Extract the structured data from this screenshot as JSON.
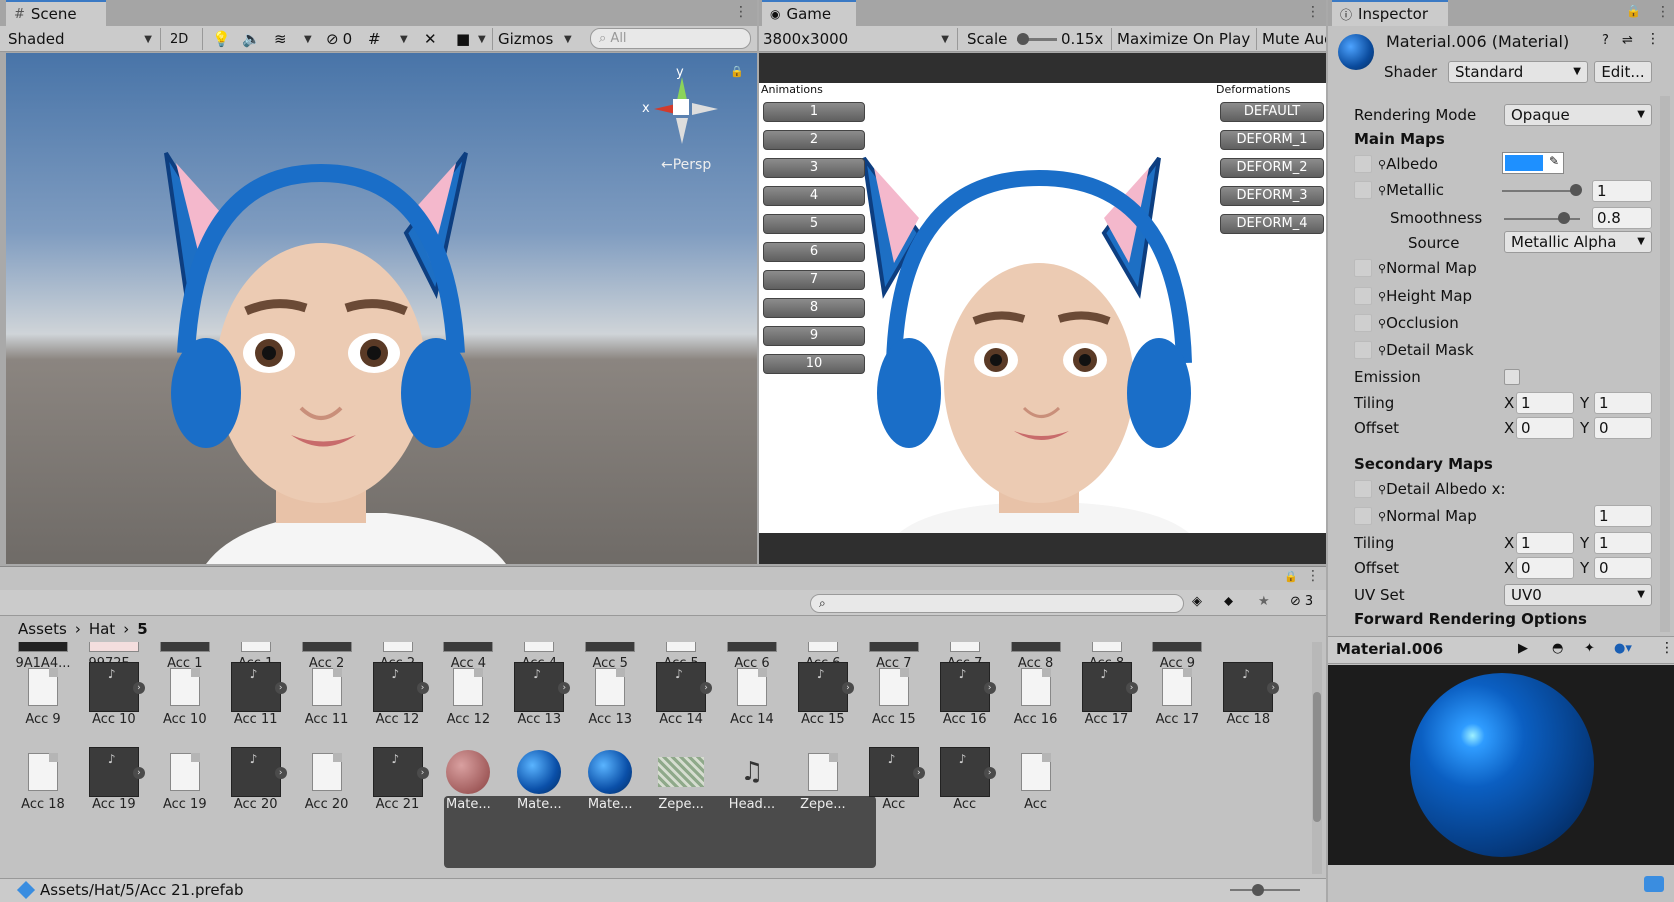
{
  "scene": {
    "tab_label": "Scene",
    "shading_mode": "Shaded",
    "mode_2d": "2D",
    "hidden_count": "0",
    "gizmos_label": "Gizmos",
    "search_placeholder": "All",
    "persp_label": "←Persp",
    "gizmo_y": "y",
    "gizmo_x": "x"
  },
  "game": {
    "tab_label": "Game",
    "resolution": "3800x3000",
    "scale_label": "Scale",
    "scale_value": "0.15x",
    "maximize_label": "Maximize On Play",
    "mute_label": "Mute Aud",
    "animations_title": "Animations",
    "deformations_title": "Deformations",
    "animation_buttons": [
      "1",
      "2",
      "3",
      "4",
      "5",
      "6",
      "7",
      "8",
      "9",
      "10"
    ],
    "deformation_buttons": [
      "DEFAULT",
      "DEFORM_1",
      "DEFORM_2",
      "DEFORM_3",
      "DEFORM_4"
    ]
  },
  "inspector": {
    "tab_label": "Inspector",
    "material_name": "Material.006 (Material)",
    "shader_label": "Shader",
    "shader_value": "Standard",
    "edit_label": "Edit...",
    "rendering_mode_label": "Rendering Mode",
    "rendering_mode_value": "Opaque",
    "main_maps_header": "Main Maps",
    "albedo_label": "Albedo",
    "albedo_color": "#1e90ff",
    "metallic_label": "Metallic",
    "metallic_value": "1",
    "smoothness_label": "Smoothness",
    "smoothness_value": "0.8",
    "source_label": "Source",
    "source_value": "Metallic Alpha",
    "normal_map_label": "Normal Map",
    "height_map_label": "Height Map",
    "occlusion_label": "Occlusion",
    "detail_mask_label": "Detail Mask",
    "emission_label": "Emission",
    "tiling_label": "Tiling",
    "tiling_x": "1",
    "tiling_y": "1",
    "offset_label": "Offset",
    "offset_x": "0",
    "offset_y": "0",
    "x_label": "X",
    "y_label": "Y",
    "secondary_maps_header": "Secondary Maps",
    "detail_albedo_label": "Detail Albedo x:",
    "sec_normal_map_label": "Normal Map",
    "sec_normal_value": "1",
    "sec_tiling_x": "1",
    "sec_tiling_y": "1",
    "sec_offset_x": "0",
    "sec_offset_y": "0",
    "uv_set_label": "UV Set",
    "uv_set_value": "UV0",
    "forward_label": "Forward Rendering Options",
    "preview_title": "Material.006"
  },
  "project": {
    "breadcrumb": [
      "Assets",
      "Hat",
      "5"
    ],
    "hidden_count": "3",
    "status_path": "Assets/Hat/5/Acc 21.prefab",
    "row1": [
      "9A1A4...",
      "9972F...",
      "Acc 1",
      "Acc 1",
      "Acc 2",
      "Acc 2",
      "Acc 4",
      "Acc 4",
      "Acc 5",
      "Acc 5",
      "Acc 6",
      "Acc 6",
      "Acc 7",
      "Acc 7",
      "Acc 8",
      "Acc 8",
      "Acc 9"
    ],
    "row2": [
      "Acc 9",
      "Acc 10",
      "Acc 10",
      "Acc 11",
      "Acc 11",
      "Acc 12",
      "Acc 12",
      "Acc 13",
      "Acc 13",
      "Acc 14",
      "Acc 14",
      "Acc 15",
      "Acc 15",
      "Acc 16",
      "Acc 16",
      "Acc 17",
      "Acc 17",
      "Acc 18"
    ],
    "row3": [
      "Acc 18",
      "Acc 19",
      "Acc 19",
      "Acc 20",
      "Acc 20",
      "Acc 21",
      "Mate...",
      "Mate...",
      "Mate...",
      "Zepe...",
      "Head...",
      "Zepe...",
      "Acc",
      "Acc",
      "Acc"
    ]
  }
}
